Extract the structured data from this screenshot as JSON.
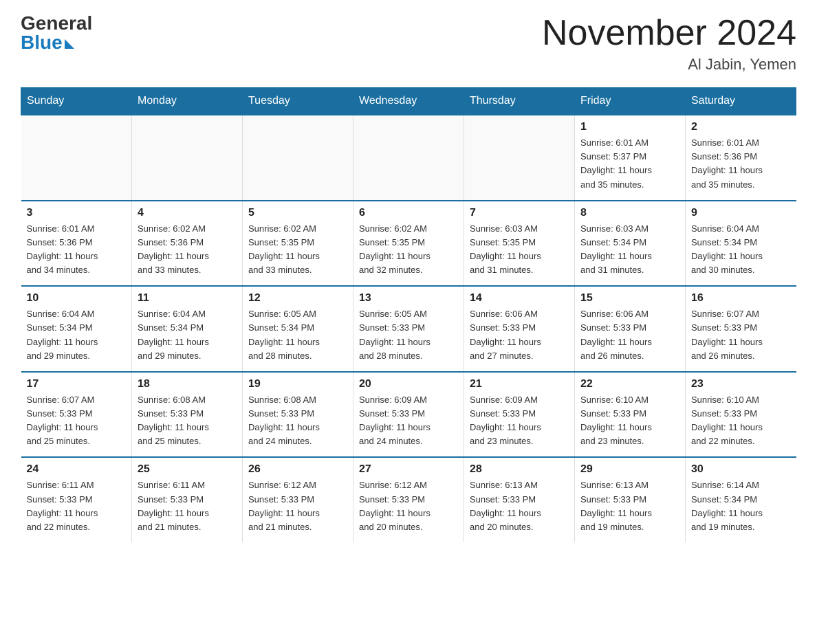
{
  "header": {
    "logo_general": "General",
    "logo_blue": "Blue",
    "title": "November 2024",
    "subtitle": "Al Jabin, Yemen"
  },
  "weekdays": [
    "Sunday",
    "Monday",
    "Tuesday",
    "Wednesday",
    "Thursday",
    "Friday",
    "Saturday"
  ],
  "weeks": [
    [
      {
        "day": "",
        "info": ""
      },
      {
        "day": "",
        "info": ""
      },
      {
        "day": "",
        "info": ""
      },
      {
        "day": "",
        "info": ""
      },
      {
        "day": "",
        "info": ""
      },
      {
        "day": "1",
        "info": "Sunrise: 6:01 AM\nSunset: 5:37 PM\nDaylight: 11 hours\nand 35 minutes."
      },
      {
        "day": "2",
        "info": "Sunrise: 6:01 AM\nSunset: 5:36 PM\nDaylight: 11 hours\nand 35 minutes."
      }
    ],
    [
      {
        "day": "3",
        "info": "Sunrise: 6:01 AM\nSunset: 5:36 PM\nDaylight: 11 hours\nand 34 minutes."
      },
      {
        "day": "4",
        "info": "Sunrise: 6:02 AM\nSunset: 5:36 PM\nDaylight: 11 hours\nand 33 minutes."
      },
      {
        "day": "5",
        "info": "Sunrise: 6:02 AM\nSunset: 5:35 PM\nDaylight: 11 hours\nand 33 minutes."
      },
      {
        "day": "6",
        "info": "Sunrise: 6:02 AM\nSunset: 5:35 PM\nDaylight: 11 hours\nand 32 minutes."
      },
      {
        "day": "7",
        "info": "Sunrise: 6:03 AM\nSunset: 5:35 PM\nDaylight: 11 hours\nand 31 minutes."
      },
      {
        "day": "8",
        "info": "Sunrise: 6:03 AM\nSunset: 5:34 PM\nDaylight: 11 hours\nand 31 minutes."
      },
      {
        "day": "9",
        "info": "Sunrise: 6:04 AM\nSunset: 5:34 PM\nDaylight: 11 hours\nand 30 minutes."
      }
    ],
    [
      {
        "day": "10",
        "info": "Sunrise: 6:04 AM\nSunset: 5:34 PM\nDaylight: 11 hours\nand 29 minutes."
      },
      {
        "day": "11",
        "info": "Sunrise: 6:04 AM\nSunset: 5:34 PM\nDaylight: 11 hours\nand 29 minutes."
      },
      {
        "day": "12",
        "info": "Sunrise: 6:05 AM\nSunset: 5:34 PM\nDaylight: 11 hours\nand 28 minutes."
      },
      {
        "day": "13",
        "info": "Sunrise: 6:05 AM\nSunset: 5:33 PM\nDaylight: 11 hours\nand 28 minutes."
      },
      {
        "day": "14",
        "info": "Sunrise: 6:06 AM\nSunset: 5:33 PM\nDaylight: 11 hours\nand 27 minutes."
      },
      {
        "day": "15",
        "info": "Sunrise: 6:06 AM\nSunset: 5:33 PM\nDaylight: 11 hours\nand 26 minutes."
      },
      {
        "day": "16",
        "info": "Sunrise: 6:07 AM\nSunset: 5:33 PM\nDaylight: 11 hours\nand 26 minutes."
      }
    ],
    [
      {
        "day": "17",
        "info": "Sunrise: 6:07 AM\nSunset: 5:33 PM\nDaylight: 11 hours\nand 25 minutes."
      },
      {
        "day": "18",
        "info": "Sunrise: 6:08 AM\nSunset: 5:33 PM\nDaylight: 11 hours\nand 25 minutes."
      },
      {
        "day": "19",
        "info": "Sunrise: 6:08 AM\nSunset: 5:33 PM\nDaylight: 11 hours\nand 24 minutes."
      },
      {
        "day": "20",
        "info": "Sunrise: 6:09 AM\nSunset: 5:33 PM\nDaylight: 11 hours\nand 24 minutes."
      },
      {
        "day": "21",
        "info": "Sunrise: 6:09 AM\nSunset: 5:33 PM\nDaylight: 11 hours\nand 23 minutes."
      },
      {
        "day": "22",
        "info": "Sunrise: 6:10 AM\nSunset: 5:33 PM\nDaylight: 11 hours\nand 23 minutes."
      },
      {
        "day": "23",
        "info": "Sunrise: 6:10 AM\nSunset: 5:33 PM\nDaylight: 11 hours\nand 22 minutes."
      }
    ],
    [
      {
        "day": "24",
        "info": "Sunrise: 6:11 AM\nSunset: 5:33 PM\nDaylight: 11 hours\nand 22 minutes."
      },
      {
        "day": "25",
        "info": "Sunrise: 6:11 AM\nSunset: 5:33 PM\nDaylight: 11 hours\nand 21 minutes."
      },
      {
        "day": "26",
        "info": "Sunrise: 6:12 AM\nSunset: 5:33 PM\nDaylight: 11 hours\nand 21 minutes."
      },
      {
        "day": "27",
        "info": "Sunrise: 6:12 AM\nSunset: 5:33 PM\nDaylight: 11 hours\nand 20 minutes."
      },
      {
        "day": "28",
        "info": "Sunrise: 6:13 AM\nSunset: 5:33 PM\nDaylight: 11 hours\nand 20 minutes."
      },
      {
        "day": "29",
        "info": "Sunrise: 6:13 AM\nSunset: 5:33 PM\nDaylight: 11 hours\nand 19 minutes."
      },
      {
        "day": "30",
        "info": "Sunrise: 6:14 AM\nSunset: 5:34 PM\nDaylight: 11 hours\nand 19 minutes."
      }
    ]
  ]
}
